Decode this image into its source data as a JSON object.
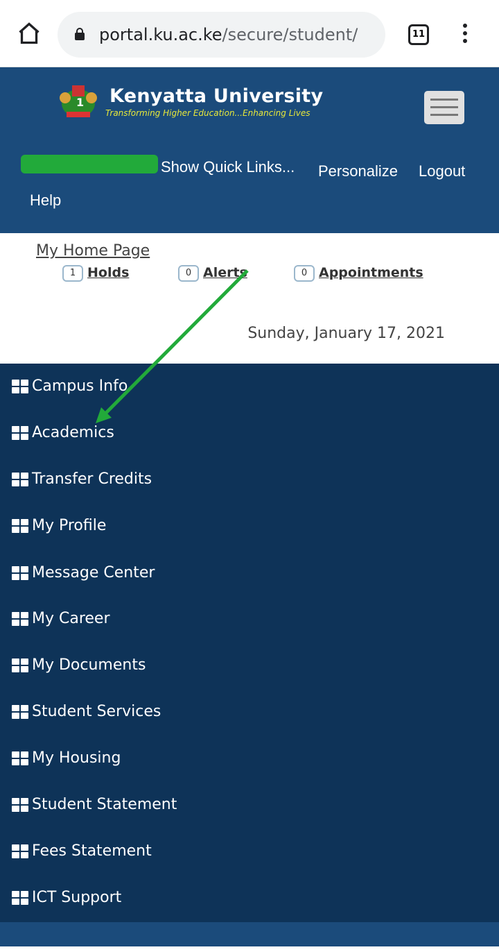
{
  "browser": {
    "url_host": "portal.ku.ac.ke",
    "url_path": "/secure/student/",
    "tab_count": "11"
  },
  "header": {
    "title": "Kenyatta University",
    "tagline": "Transforming Higher Education...Enhancing Lives",
    "quick_links": "Show Quick Links...",
    "personalize": "Personalize",
    "logout": "Logout",
    "help": "Help"
  },
  "home": {
    "link": "My Home Page",
    "holds_count": "1",
    "holds": "Holds",
    "alerts_count": "0",
    "alerts": "Alerts",
    "appointments_count": "0",
    "appointments": "Appointments",
    "date": "Sunday, January 17, 2021"
  },
  "menu": {
    "items": [
      "Campus Info",
      "Academics",
      "Transfer Credits",
      "My Profile",
      "Message Center",
      "My Career",
      "My Documents",
      "Student Services",
      "My Housing",
      "Student Statement",
      "Fees Statement",
      "ICT Support"
    ]
  },
  "colors": {
    "header": "#1b4b7b",
    "menu": "#0e3358",
    "annotation_arrow": "#22aa3a"
  }
}
